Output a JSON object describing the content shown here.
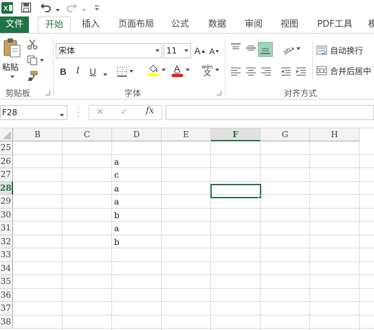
{
  "quick_access": {
    "app_icon": "excel-icon",
    "save_icon": "save-icon",
    "undo_icon": "undo-icon",
    "redo_icon": "redo-icon",
    "customize_icon": "customize-qat-icon"
  },
  "tabs": [
    {
      "label": "文件"
    },
    {
      "label": "开始"
    },
    {
      "label": "插入"
    },
    {
      "label": "页面布局"
    },
    {
      "label": "公式"
    },
    {
      "label": "数据"
    },
    {
      "label": "审阅"
    },
    {
      "label": "视图"
    },
    {
      "label": "PDF工具"
    },
    {
      "label": "模"
    }
  ],
  "ribbon": {
    "clipboard": {
      "paste_label": "粘贴",
      "group_label": "剪贴板"
    },
    "font": {
      "font_name": "宋体",
      "font_size": "11",
      "bold": "B",
      "italic": "I",
      "underline": "U",
      "grow": "A",
      "shrink": "A",
      "font_color_letter": "A",
      "phonetic": "wén",
      "highlight_color": "#FFFF00",
      "font_color": "#FF0000",
      "group_label": "字体"
    },
    "alignment": {
      "wrap_text": "自动换行",
      "merge_center": "合并后居中",
      "group_label": "对齐方式"
    }
  },
  "formula_bar": {
    "name_box": "F28",
    "fx": "fx",
    "cancel": "✕",
    "enter": "✓",
    "formula": ""
  },
  "grid": {
    "columns": [
      "B",
      "C",
      "D",
      "E",
      "F",
      "G",
      "H"
    ],
    "selected_column": "F",
    "rows": [
      "25",
      "26",
      "27",
      "28",
      "29",
      "30",
      "31",
      "32",
      "33",
      "34",
      "35",
      "36",
      "37",
      "38"
    ],
    "selected_row": "28",
    "active_cell": "F28",
    "column_d_values": {
      "25": "",
      "26": "a",
      "27": "c",
      "28": "a",
      "29": "a",
      "30": "b",
      "31": "a",
      "32": "b",
      "33": "",
      "34": "",
      "35": "",
      "36": "",
      "37": "",
      "38": ""
    },
    "accent_color": "#217346"
  }
}
